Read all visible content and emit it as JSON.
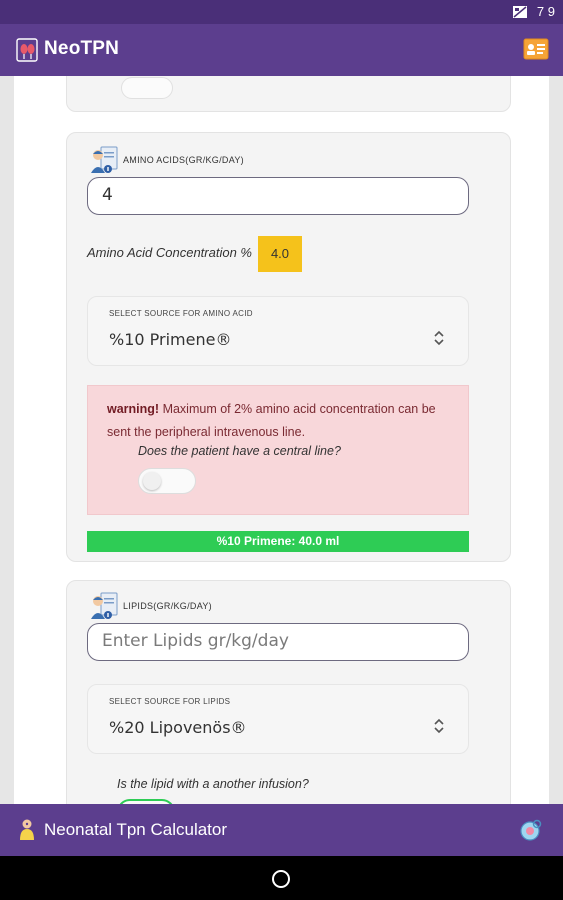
{
  "status": {
    "time": "7 9"
  },
  "app": {
    "title": "NeoTPN"
  },
  "amino": {
    "header": "AMINO ACIDS(GR/KG/DAY)",
    "value": "4",
    "concentration_label": "Amino Acid Concentration %",
    "concentration_value": "4.0",
    "select_label": "SELECT SOURCE FOR AMINO ACID",
    "select_value": "%10 Primene®",
    "warning_strong": "warning!",
    "warning_text": " Maximum of 2% amino acid concentration can be sent the peripheral intravenous line.",
    "central_line_question": "Does the patient have a central line?",
    "result": "%10 Primene: 40.0 ml"
  },
  "lipids": {
    "header": "LIPIDS(GR/KG/DAY)",
    "placeholder": "Enter Lipids gr/kg/day",
    "select_label": "SELECT SOURCE FOR LIPIDS",
    "select_value": "%20 Lipovenös®",
    "infusion_question": "Is the lipid with a another infusion?"
  },
  "bottom": {
    "title": "Neonatal Tpn Calculator"
  },
  "colors": {
    "primary": "#5c3e8e",
    "status": "#4a2f78",
    "warning_bg": "#f8d7da",
    "badge": "#f5c21b",
    "success": "#2ecc55"
  },
  "icons": {
    "app_logo": "kidney-logo-icon",
    "app_action": "id-card-icon",
    "section_header": "doctor-clipboard-icon",
    "select_arrow": "chevron-updown-icon",
    "bottom_left": "baby-icon",
    "bottom_right": "pacifier-icon"
  }
}
